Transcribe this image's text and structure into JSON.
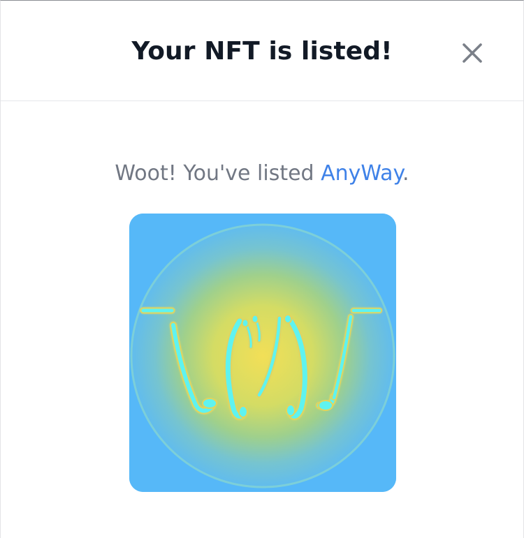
{
  "modal": {
    "title": "Your NFT is listed!",
    "close_icon": "close-icon",
    "message_prefix": "Woot! You've listed ",
    "asset_name": "AnyWay",
    "message_suffix": ".",
    "nft_image": {
      "icon": "shrug-emoticon-artwork",
      "colors": {
        "background": "#56b8f8",
        "center_glow": "#f2df57",
        "mid_glow": "#9fd08c",
        "outer_glow": "#68bdf0",
        "strokes": "#5ff3f0",
        "stroke_outline": "#e0d55e"
      }
    }
  }
}
